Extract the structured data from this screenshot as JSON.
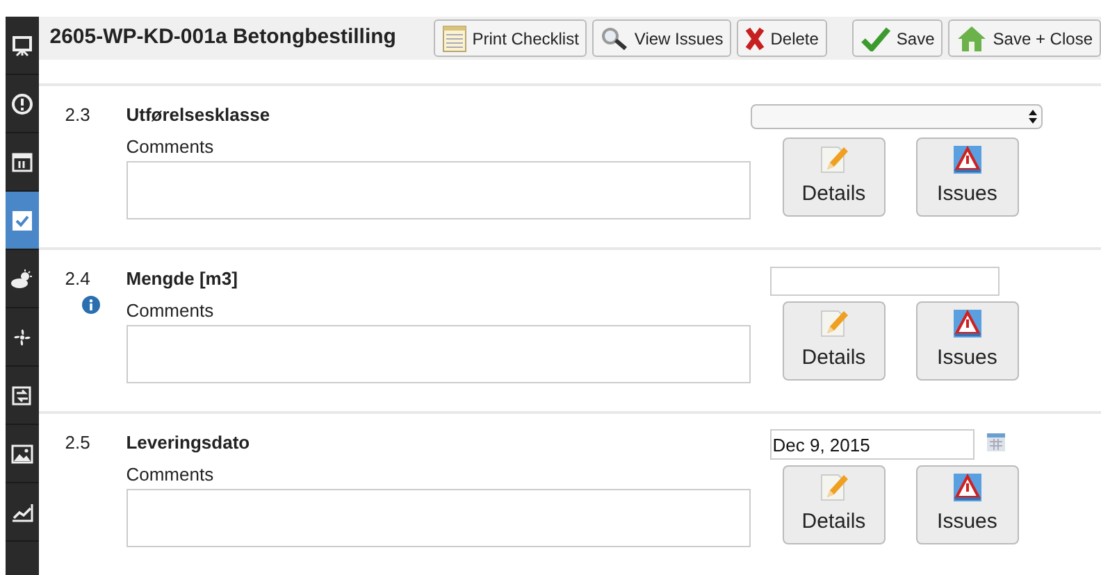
{
  "sidebar": {
    "items": [
      {
        "selected": false
      },
      {
        "selected": false
      },
      {
        "selected": false
      },
      {
        "selected": true
      },
      {
        "selected": false
      },
      {
        "selected": false
      },
      {
        "selected": false
      },
      {
        "selected": false
      },
      {
        "selected": false
      }
    ]
  },
  "header": {
    "title": "2605-WP-KD-001a Betongbestilling",
    "buttons": [
      {
        "label": "Print Checklist",
        "kind": "print"
      },
      {
        "label": "View Issues",
        "kind": "issues"
      },
      {
        "label": "Delete",
        "kind": "delete"
      },
      {
        "label": "Save",
        "kind": "save"
      },
      {
        "label": "Save + Close",
        "kind": "save_close"
      }
    ]
  },
  "rows": [
    {
      "number": "2.3",
      "title": "Utførelsesklasse",
      "info": false,
      "comments_label": "Comments",
      "field": {
        "kind": "select"
      },
      "buttons": [
        {
          "label": "Details",
          "kind": "details"
        },
        {
          "label": "Issues",
          "kind": "issues"
        }
      ]
    },
    {
      "number": "2.4",
      "title": "Mengde [m3]",
      "info": true,
      "comments_label": "Comments",
      "field": {
        "kind": "text"
      },
      "buttons": [
        {
          "label": "Details",
          "kind": "details"
        },
        {
          "label": "Issues",
          "kind": "issues"
        }
      ]
    },
    {
      "number": "2.5",
      "title": "Leveringsdato",
      "info": false,
      "comments_label": "Comments",
      "field": {
        "kind": "date",
        "value": "Dec 9, 2015"
      },
      "buttons": [
        {
          "label": "Details",
          "kind": "details"
        },
        {
          "label": "Issues",
          "kind": "issues"
        }
      ]
    }
  ]
}
